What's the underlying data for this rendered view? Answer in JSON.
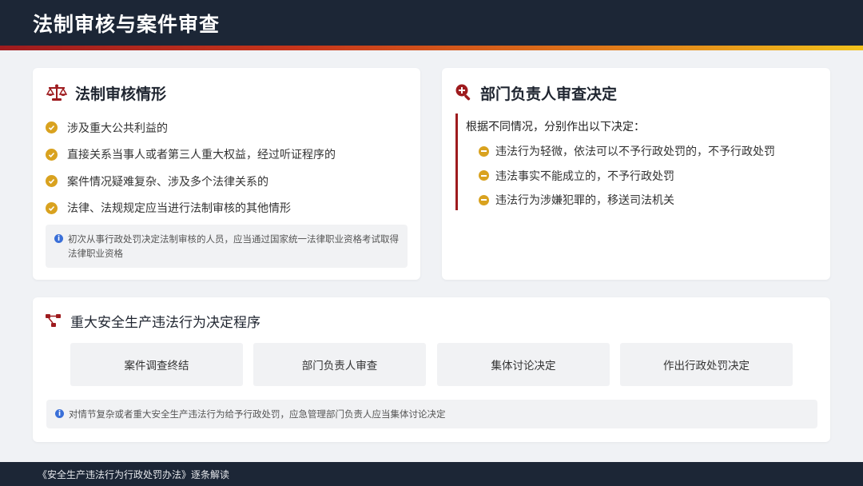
{
  "header": {
    "title": "法制审核与案件审查"
  },
  "review_card": {
    "title": "法制审核情形",
    "items": [
      "涉及重大公共利益的",
      "直接关系当事人或者第三人重大权益，经过听证程序的",
      "案件情况疑难复杂、涉及多个法律关系的",
      "法律、法规规定应当进行法制审核的其他情形"
    ],
    "note": "初次从事行政处罚决定法制审核的人员，应当通过国家统一法律职业资格考试取得法律职业资格"
  },
  "decision_card": {
    "title": "部门负责人审查决定",
    "intro": "根据不同情况，分别作出以下决定：",
    "items": [
      "违法行为轻微，依法可以不予行政处罚的，不予行政处罚",
      "违法事实不能成立的，不予行政处罚",
      "违法行为涉嫌犯罪的，移送司法机关"
    ]
  },
  "procedure_card": {
    "title": "重大安全生产违法行为决定程序",
    "steps": [
      "案件调查终结",
      "部门负责人审查",
      "集体讨论决定",
      "作出行政处罚决定"
    ],
    "note": "对情节复杂或者重大安全生产违法行为给予行政处罚，应急管理部门负责人应当集体讨论决定"
  },
  "footer": {
    "text": "《安全生产违法行为行政处罚办法》逐条解读"
  },
  "colors": {
    "dark": "#1c2636",
    "accent_red": "#9e1b1e",
    "gold": "#d9a21f",
    "info_blue": "#3a6fd8"
  },
  "icons": {
    "review": "scale-icon",
    "decision": "search-plus-icon",
    "procedure": "flow-icon"
  }
}
